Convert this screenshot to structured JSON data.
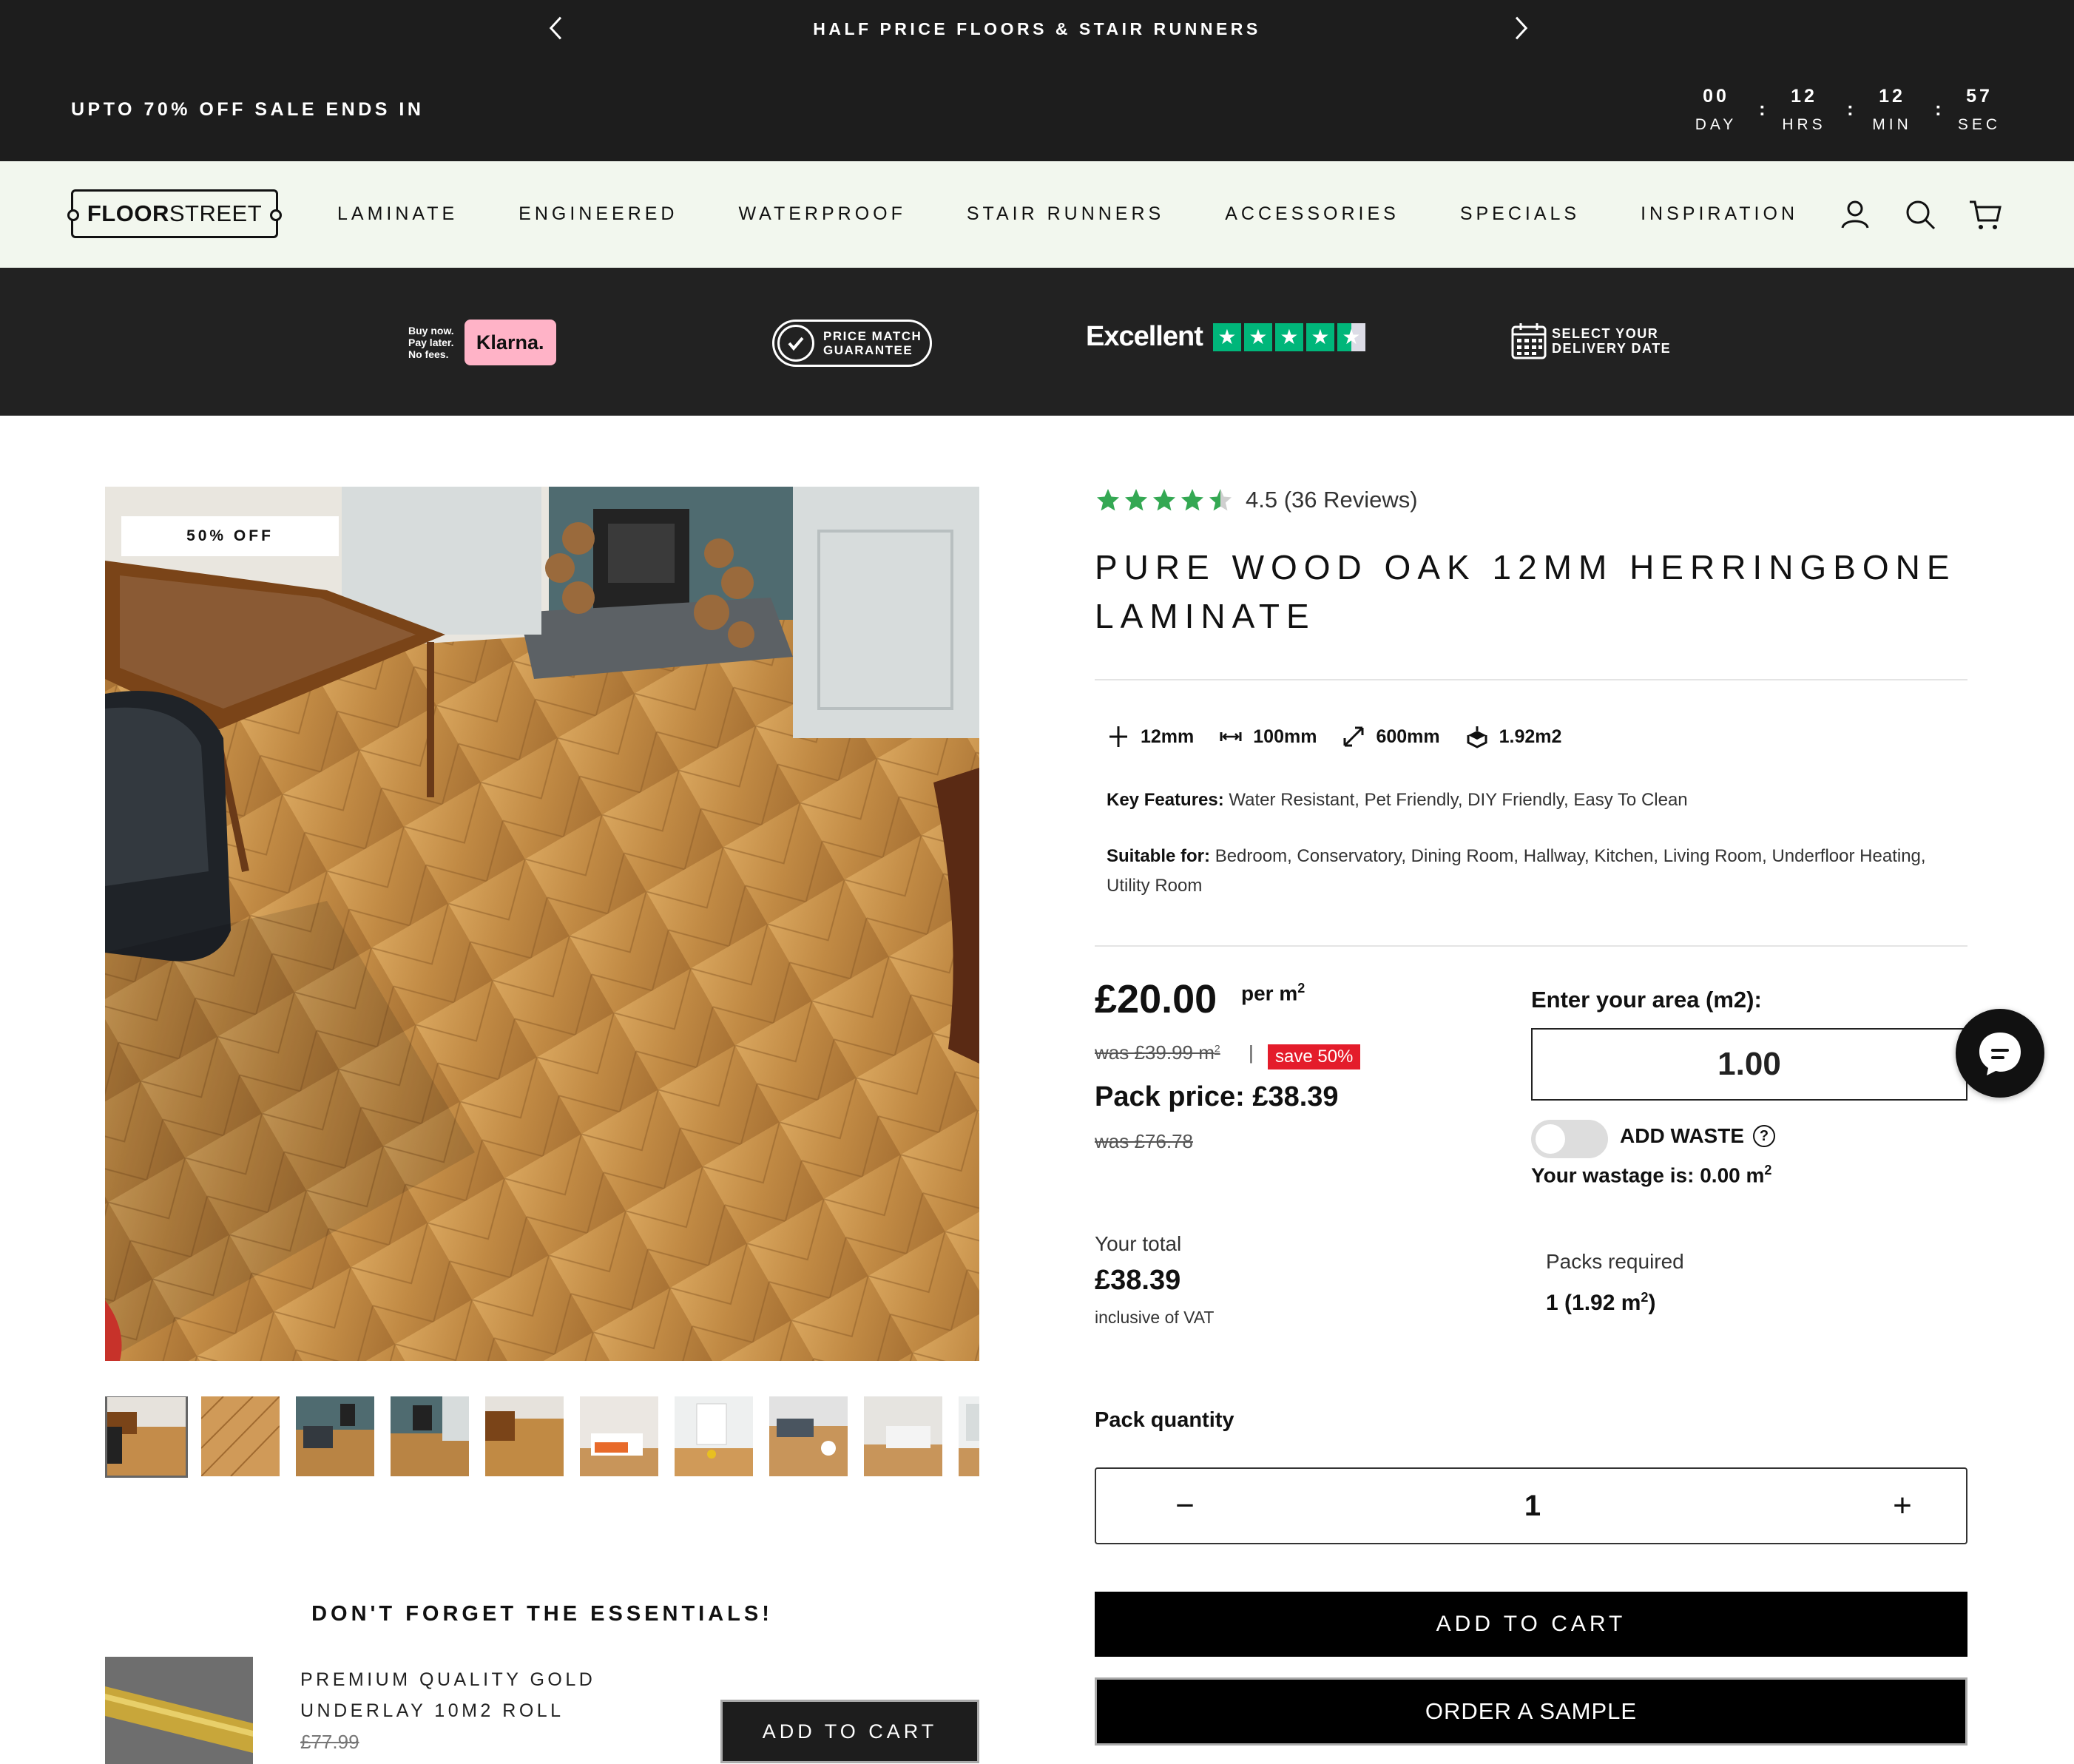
{
  "promo": {
    "message": "HALF PRICE FLOORS & STAIR RUNNERS",
    "sale_label": "UPTO 70% OFF SALE ENDS IN",
    "countdown": [
      {
        "value": "00",
        "label": "DAY"
      },
      {
        "value": "12",
        "label": "HRS"
      },
      {
        "value": "12",
        "label": "MIN"
      },
      {
        "value": "57",
        "label": "SEC"
      }
    ],
    "separator": ":"
  },
  "nav": {
    "logo_bold": "FLOOR",
    "logo_light": "STREET",
    "links": [
      "LAMINATE",
      "ENGINEERED",
      "WATERPROOF",
      "STAIR RUNNERS",
      "ACCESSORIES",
      "SPECIALS",
      "INSPIRATION"
    ]
  },
  "trust": {
    "klarna_small": [
      "Buy now.",
      "Pay later.",
      "No fees."
    ],
    "klarna_logo": "Klarna.",
    "price_match": [
      "PRICE MATCH",
      "GUARANTEE"
    ],
    "trustpilot_label": "Excellent",
    "trustpilot_stars": 4.5,
    "delivery": [
      "SELECT YOUR",
      "DELIVERY DATE"
    ]
  },
  "gallery": {
    "badge": "50% OFF",
    "thumb_count": 10
  },
  "essentials": {
    "title": "DON'T FORGET THE ESSENTIALS!",
    "product_name": "PREMIUM QUALITY GOLD UNDERLAY 10M2 ROLL",
    "product_price": "£77.99",
    "button": "ADD TO CART"
  },
  "product": {
    "rating_value": 4.5,
    "rating_text": "4.5 (36 Reviews)",
    "title": "PURE WOOD OAK 12MM HERRINGBONE LAMINATE",
    "specs": [
      {
        "icon": "thickness-icon",
        "value": "12mm"
      },
      {
        "icon": "width-icon",
        "value": "100mm"
      },
      {
        "icon": "length-icon",
        "value": "600mm"
      },
      {
        "icon": "pack-icon",
        "value": "1.92m2"
      }
    ],
    "key_features_label": "Key Features:",
    "key_features": "Water Resistant, Pet Friendly, DIY Friendly, Easy To Clean",
    "suitable_label": "Suitable for:",
    "suitable": "Bedroom, Conservatory, Dining Room, Hallway, Kitchen, Living Room, Underfloor Heating, Utility Room",
    "price": "£20.00",
    "price_unit": "per m",
    "was": "was £39.99 m",
    "save": "save 50%",
    "pack_price": "Pack price:  £38.39",
    "pack_was": "was £76.78",
    "area_label": "Enter your area (m2):",
    "area_value": "1.00",
    "waste_label": "ADD WASTE",
    "wastage": "Your wastage is: 0.00 m",
    "total_label": "Your total",
    "total": "£38.39",
    "vat": "inclusive of VAT",
    "packs_label": "Packs required",
    "packs_value": "1 (1.92 m",
    "packs_close": ")",
    "pack_qty_label": "Pack quantity",
    "qty_minus": "−",
    "qty": "1",
    "qty_plus": "+",
    "add_to_cart": "ADD TO CART",
    "order_sample": "ORDER A SAMPLE"
  },
  "colors": {
    "dark_bar": "#1d1d1d",
    "nav_bg": "#f2f7ee",
    "star_green": "#34a853",
    "save_red": "#e41c2b",
    "trustpilot": "#00b67a"
  }
}
